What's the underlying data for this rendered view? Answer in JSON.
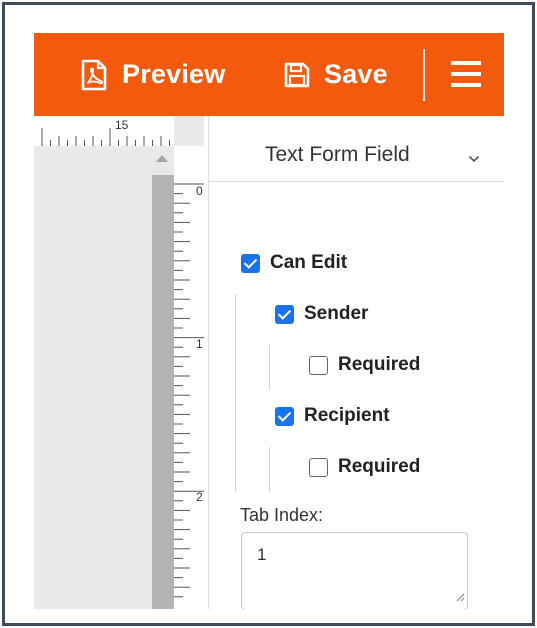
{
  "toolbar": {
    "preview_label": "Preview",
    "save_label": "Save",
    "preview_icon": "pdf-file-icon",
    "save_icon": "floppy-disk-icon",
    "menu_icon": "hamburger-menu-icon",
    "background_color": "#f45a0d"
  },
  "ruler": {
    "horizontal_label": "15",
    "vertical_labels": [
      "0",
      "1",
      "2"
    ]
  },
  "panel": {
    "title": "Text Form Field",
    "dropdown_icon": "chevron-down-icon",
    "can_edit": {
      "label": "Can Edit",
      "checked": true
    },
    "sender": {
      "label": "Sender",
      "checked": true,
      "required_label": "Required",
      "required_checked": false
    },
    "recipient": {
      "label": "Recipient",
      "checked": true,
      "required_label": "Required",
      "required_checked": false
    },
    "tab_index": {
      "label": "Tab Index:",
      "value": "1"
    },
    "accent_color": "#1a73e8"
  }
}
